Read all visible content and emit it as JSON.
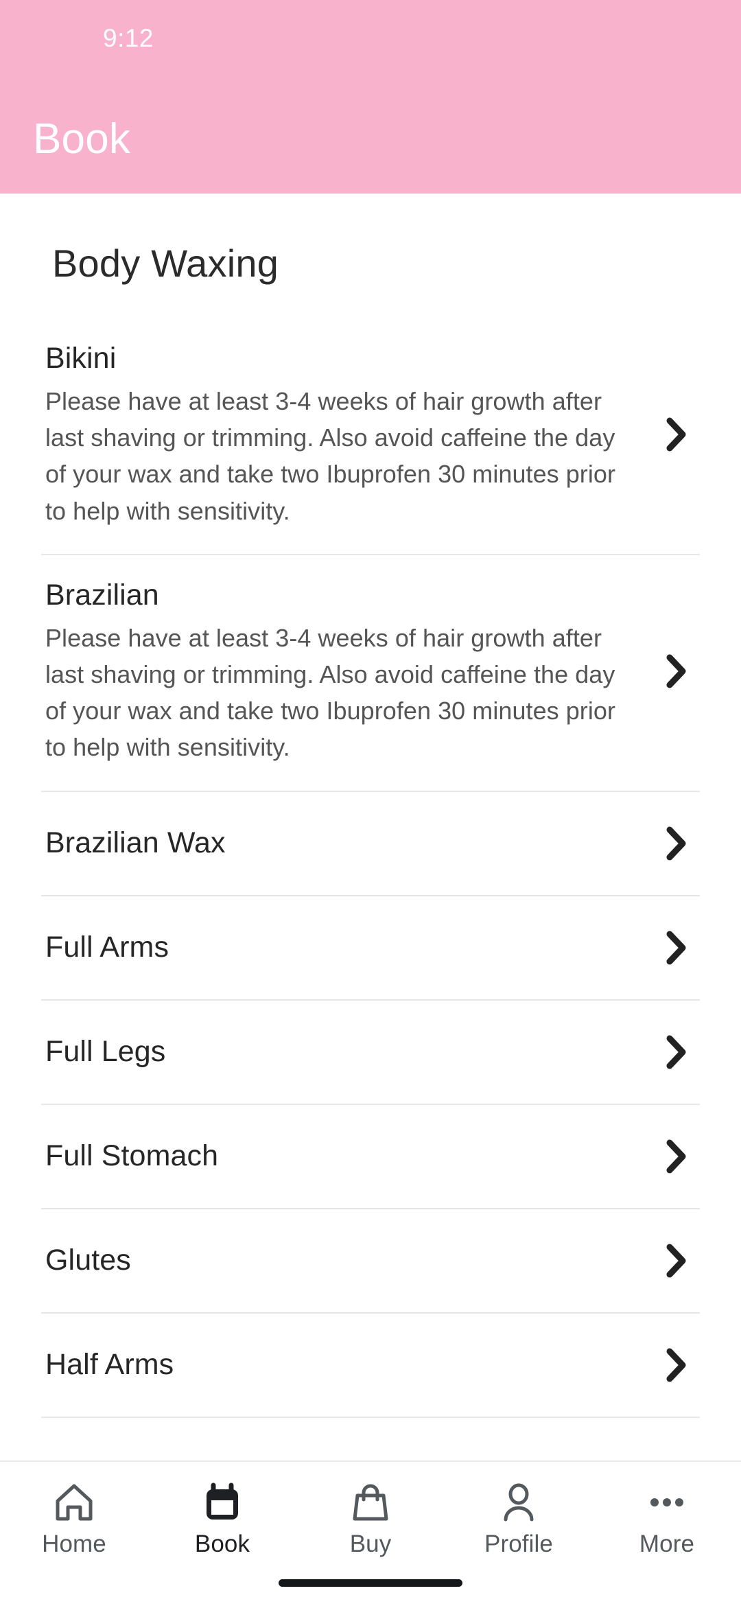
{
  "status_bar": {
    "time": "9:12"
  },
  "header": {
    "title": "Book",
    "background_color": "#f9b2cb",
    "text_color": "#ffffff"
  },
  "page": {
    "title": "Body Waxing"
  },
  "services": [
    {
      "name": "Bikini",
      "description": "Please have at least 3-4 weeks of hair growth after last shaving or trimming. Also avoid caffeine the day of your wax and take two Ibuprofen 30 minutes prior to help with sensitivity.",
      "chevron_icon": "chevron-right-icon"
    },
    {
      "name": "Brazilian",
      "description": "Please have at least 3-4 weeks of hair growth after last shaving or trimming. Also avoid caffeine the day of your wax and take two Ibuprofen 30 minutes prior to help with sensitivity.",
      "chevron_icon": "chevron-right-icon"
    },
    {
      "name": "Brazilian Wax",
      "description": "",
      "chevron_icon": "chevron-right-icon"
    },
    {
      "name": "Full Arms",
      "description": "",
      "chevron_icon": "chevron-right-icon"
    },
    {
      "name": "Full Legs",
      "description": "",
      "chevron_icon": "chevron-right-icon"
    },
    {
      "name": "Full Stomach",
      "description": "",
      "chevron_icon": "chevron-right-icon"
    },
    {
      "name": "Glutes",
      "description": "",
      "chevron_icon": "chevron-right-icon"
    },
    {
      "name": "Half Arms",
      "description": "",
      "chevron_icon": "chevron-right-icon"
    }
  ],
  "bottom_nav": {
    "items": [
      {
        "label": "Home",
        "icon": "home-icon",
        "active": false
      },
      {
        "label": "Book",
        "icon": "calendar-icon",
        "active": true
      },
      {
        "label": "Buy",
        "icon": "bag-icon",
        "active": false
      },
      {
        "label": "Profile",
        "icon": "person-icon",
        "active": false
      },
      {
        "label": "More",
        "icon": "ellipsis-icon",
        "active": false
      }
    ]
  }
}
